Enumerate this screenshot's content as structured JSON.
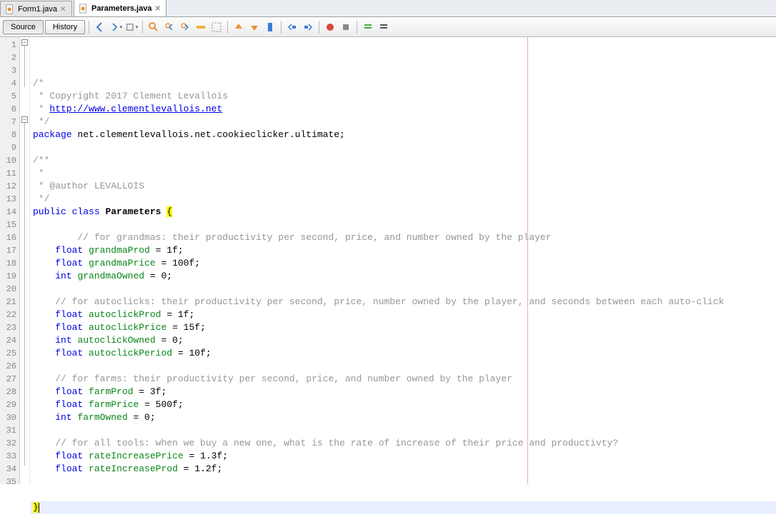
{
  "tabs": [
    {
      "label": "Form1.java",
      "active": false
    },
    {
      "label": "Parameters.java",
      "active": true
    }
  ],
  "toolbar": {
    "source": "Source",
    "history": "History"
  },
  "code": {
    "lines": [
      {
        "n": 1,
        "fragments": [
          {
            "t": "/*",
            "c": "cmt"
          }
        ]
      },
      {
        "n": 2,
        "fragments": [
          {
            "t": " * Copyright 2017 Clement Levallois",
            "c": "cmt"
          }
        ]
      },
      {
        "n": 3,
        "fragments": [
          {
            "t": " * ",
            "c": "cmt"
          },
          {
            "t": "http://www.clementlevallois.net",
            "c": "doc-link"
          }
        ]
      },
      {
        "n": 4,
        "fragments": [
          {
            "t": " */",
            "c": "cmt"
          }
        ]
      },
      {
        "n": 5,
        "fragments": [
          {
            "t": "package",
            "c": "kw"
          },
          {
            "t": " net.clementlevallois.net.cookieclicker.ultimate;"
          }
        ]
      },
      {
        "n": 6,
        "fragments": []
      },
      {
        "n": 7,
        "fragments": [
          {
            "t": "/**",
            "c": "cmt"
          }
        ]
      },
      {
        "n": 8,
        "fragments": [
          {
            "t": " *",
            "c": "cmt"
          }
        ]
      },
      {
        "n": 9,
        "fragments": [
          {
            "t": " * @author LEVALLOIS",
            "c": "cmt"
          }
        ]
      },
      {
        "n": 10,
        "fragments": [
          {
            "t": " */",
            "c": "cmt"
          }
        ]
      },
      {
        "n": 11,
        "fragments": [
          {
            "t": "public",
            "c": "kw"
          },
          {
            "t": " "
          },
          {
            "t": "class",
            "c": "kw"
          },
          {
            "t": " "
          },
          {
            "t": "Parameters",
            "c": "cls"
          },
          {
            "t": " "
          },
          {
            "t": "{",
            "c": "hl-brace"
          }
        ]
      },
      {
        "n": 12,
        "fragments": []
      },
      {
        "n": 13,
        "fragments": [
          {
            "t": "    // for grandmas: their productivity per second, price, and number owned by the player",
            "c": "cmt"
          }
        ]
      },
      {
        "n": 14,
        "fragments": [
          {
            "t": "float",
            "c": "type"
          },
          {
            "t": " "
          },
          {
            "t": "grandmaProd",
            "c": "field"
          },
          {
            "t": " = 1f;"
          }
        ]
      },
      {
        "n": 15,
        "fragments": [
          {
            "t": "float",
            "c": "type"
          },
          {
            "t": " "
          },
          {
            "t": "grandmaPrice",
            "c": "field"
          },
          {
            "t": " = 100f;"
          }
        ]
      },
      {
        "n": 16,
        "fragments": [
          {
            "t": "int",
            "c": "type"
          },
          {
            "t": " "
          },
          {
            "t": "grandmaOwned",
            "c": "field"
          },
          {
            "t": " = 0;"
          }
        ]
      },
      {
        "n": 17,
        "fragments": []
      },
      {
        "n": 18,
        "fragments": [
          {
            "t": "// for autoclicks: their productivity per second, price, number owned by the player, and seconds between each auto-click",
            "c": "cmt"
          }
        ]
      },
      {
        "n": 19,
        "fragments": [
          {
            "t": "float",
            "c": "type"
          },
          {
            "t": " "
          },
          {
            "t": "autoclickProd",
            "c": "field"
          },
          {
            "t": " = 1f;"
          }
        ]
      },
      {
        "n": 20,
        "fragments": [
          {
            "t": "float",
            "c": "type"
          },
          {
            "t": " "
          },
          {
            "t": "autoclickPrice",
            "c": "field"
          },
          {
            "t": " = 15f;"
          }
        ]
      },
      {
        "n": 21,
        "fragments": [
          {
            "t": "int",
            "c": "type"
          },
          {
            "t": " "
          },
          {
            "t": "autoclickOwned",
            "c": "field"
          },
          {
            "t": " = 0;"
          }
        ]
      },
      {
        "n": 22,
        "fragments": [
          {
            "t": "float",
            "c": "type"
          },
          {
            "t": " "
          },
          {
            "t": "autoclickPeriod",
            "c": "field"
          },
          {
            "t": " = 10f;"
          }
        ]
      },
      {
        "n": 23,
        "fragments": []
      },
      {
        "n": 24,
        "fragments": [
          {
            "t": "// for farms: their productivity per second, price, and number owned by the player",
            "c": "cmt"
          }
        ]
      },
      {
        "n": 25,
        "fragments": [
          {
            "t": "float",
            "c": "type"
          },
          {
            "t": " "
          },
          {
            "t": "farmProd",
            "c": "field"
          },
          {
            "t": " = 3f;"
          }
        ]
      },
      {
        "n": 26,
        "fragments": [
          {
            "t": "float",
            "c": "type"
          },
          {
            "t": " "
          },
          {
            "t": "farmPrice",
            "c": "field"
          },
          {
            "t": " = 500f;"
          }
        ]
      },
      {
        "n": 27,
        "fragments": [
          {
            "t": "int",
            "c": "type"
          },
          {
            "t": " "
          },
          {
            "t": "farmOwned",
            "c": "field"
          },
          {
            "t": " = 0;"
          }
        ]
      },
      {
        "n": 28,
        "fragments": []
      },
      {
        "n": 29,
        "fragments": [
          {
            "t": "// for all tools: when we buy a new one, what is the rate of increase of their price and productivty?",
            "c": "cmt"
          }
        ]
      },
      {
        "n": 30,
        "fragments": [
          {
            "t": "float",
            "c": "type"
          },
          {
            "t": " "
          },
          {
            "t": "rateIncreasePrice",
            "c": "field"
          },
          {
            "t": " = 1.3f;"
          }
        ]
      },
      {
        "n": 31,
        "fragments": [
          {
            "t": "float",
            "c": "type"
          },
          {
            "t": " "
          },
          {
            "t": "rateIncreaseProd",
            "c": "field"
          },
          {
            "t": " = 1.2f;"
          }
        ]
      },
      {
        "n": 32,
        "fragments": []
      },
      {
        "n": 33,
        "fragments": []
      },
      {
        "n": 34,
        "fragments": [
          {
            "t": "}",
            "c": "hl-brace"
          }
        ],
        "current": true
      },
      {
        "n": 35,
        "fragments": []
      }
    ]
  }
}
